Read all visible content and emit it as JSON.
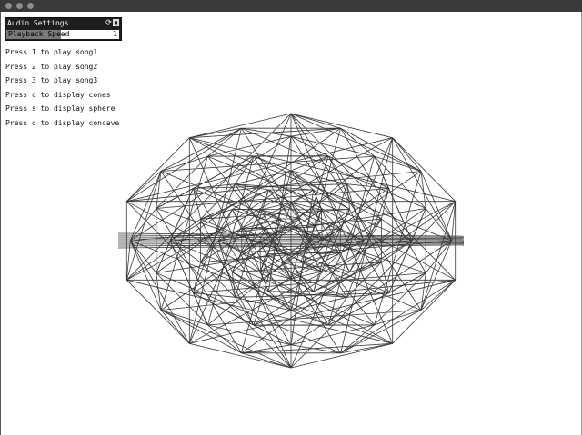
{
  "window": {
    "controls": [
      "close",
      "minimize",
      "maximize"
    ]
  },
  "gui_panel": {
    "title": "Audio Settings",
    "slider": {
      "label": "Playback Speed",
      "value": "1",
      "fill_fraction": 0.48
    }
  },
  "instructions": [
    "Press 1 to play song1",
    "Press 2 to play song2",
    "Press 3 to play song3",
    "Press c to display cones",
    "Press s to display sphere",
    "Press c to display concave"
  ],
  "visualization": {
    "shape": "wireframe-mesh",
    "stroke_color": "#3a3a3a"
  }
}
